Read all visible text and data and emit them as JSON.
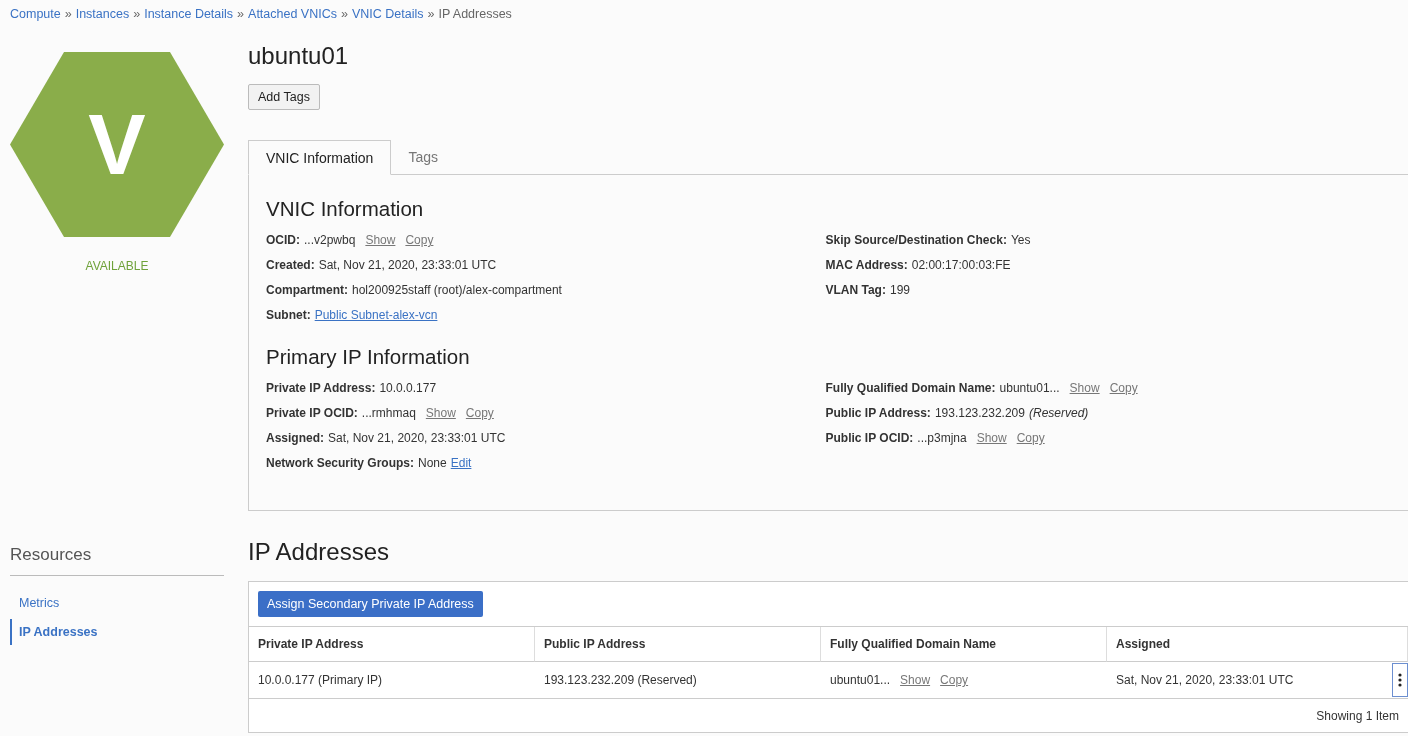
{
  "breadcrumb": [
    {
      "label": "Compute",
      "current": false
    },
    {
      "label": "Instances",
      "current": false
    },
    {
      "label": "Instance Details",
      "current": false
    },
    {
      "label": "Attached VNICs",
      "current": false
    },
    {
      "label": "VNIC Details",
      "current": false
    },
    {
      "label": "IP Addresses",
      "current": true
    }
  ],
  "breadcrumb_separator": "»",
  "resource_badge": {
    "letter": "V",
    "status": "AVAILABLE"
  },
  "title": "ubuntu01",
  "add_tags_button": "Add Tags",
  "tabs": [
    {
      "label": "VNIC Information",
      "selected": true
    },
    {
      "label": "Tags",
      "selected": false
    }
  ],
  "sections": [
    {
      "title": "VNIC Information",
      "left": [
        {
          "label": "OCID:",
          "value": "...v2pwbq",
          "actions": [
            "Show",
            "Copy"
          ]
        },
        {
          "label": "Created:",
          "value": "Sat, Nov 21, 2020, 23:33:01 UTC"
        },
        {
          "label": "Compartment:",
          "value": "hol200925staff (root)/alex-compartment"
        },
        {
          "label": "Subnet:",
          "link": "Public Subnet-alex-vcn"
        }
      ],
      "right": [
        {
          "label": "Skip Source/Destination Check:",
          "value": "Yes"
        },
        {
          "label": "MAC Address:",
          "value": "02:00:17:00:03:FE"
        },
        {
          "label": "VLAN Tag:",
          "value": "199"
        }
      ]
    },
    {
      "title": "Primary IP Information",
      "left": [
        {
          "label": "Private IP Address:",
          "value": "10.0.0.177"
        },
        {
          "label": "Private IP OCID:",
          "value": "...rmhmaq",
          "actions": [
            "Show",
            "Copy"
          ]
        },
        {
          "label": "Assigned:",
          "value": "Sat, Nov 21, 2020, 23:33:01 UTC"
        },
        {
          "label": "Network Security Groups:",
          "value": "None",
          "link": "Edit"
        }
      ],
      "right": [
        {
          "label": "Fully Qualified Domain Name:",
          "value": "ubuntu01...",
          "actions": [
            "Show",
            "Copy"
          ]
        },
        {
          "label": "Public IP Address:",
          "value": "193.123.232.209",
          "note": "(Reserved)"
        },
        {
          "label": "Public IP OCID:",
          "value": "...p3mjna",
          "actions": [
            "Show",
            "Copy"
          ]
        }
      ]
    }
  ],
  "resources": {
    "title": "Resources",
    "items": [
      {
        "label": "Metrics",
        "selected": false
      },
      {
        "label": "IP Addresses",
        "selected": true
      }
    ]
  },
  "ip_addresses": {
    "title": "IP Addresses",
    "assign_button": "Assign Secondary Private IP Address",
    "columns": [
      "Private IP Address",
      "Public IP Address",
      "Fully Qualified Domain Name",
      "Assigned"
    ],
    "rows": [
      {
        "cells": [
          {
            "value": "10.0.0.177 (Primary IP)"
          },
          {
            "value": "193.123.232.209 (Reserved)"
          },
          {
            "value": "ubuntu01...",
            "actions": [
              "Show",
              "Copy"
            ]
          },
          {
            "value": "Sat, Nov 21, 2020, 23:33:01 UTC"
          }
        ]
      }
    ],
    "footer": "Showing 1 Item"
  }
}
